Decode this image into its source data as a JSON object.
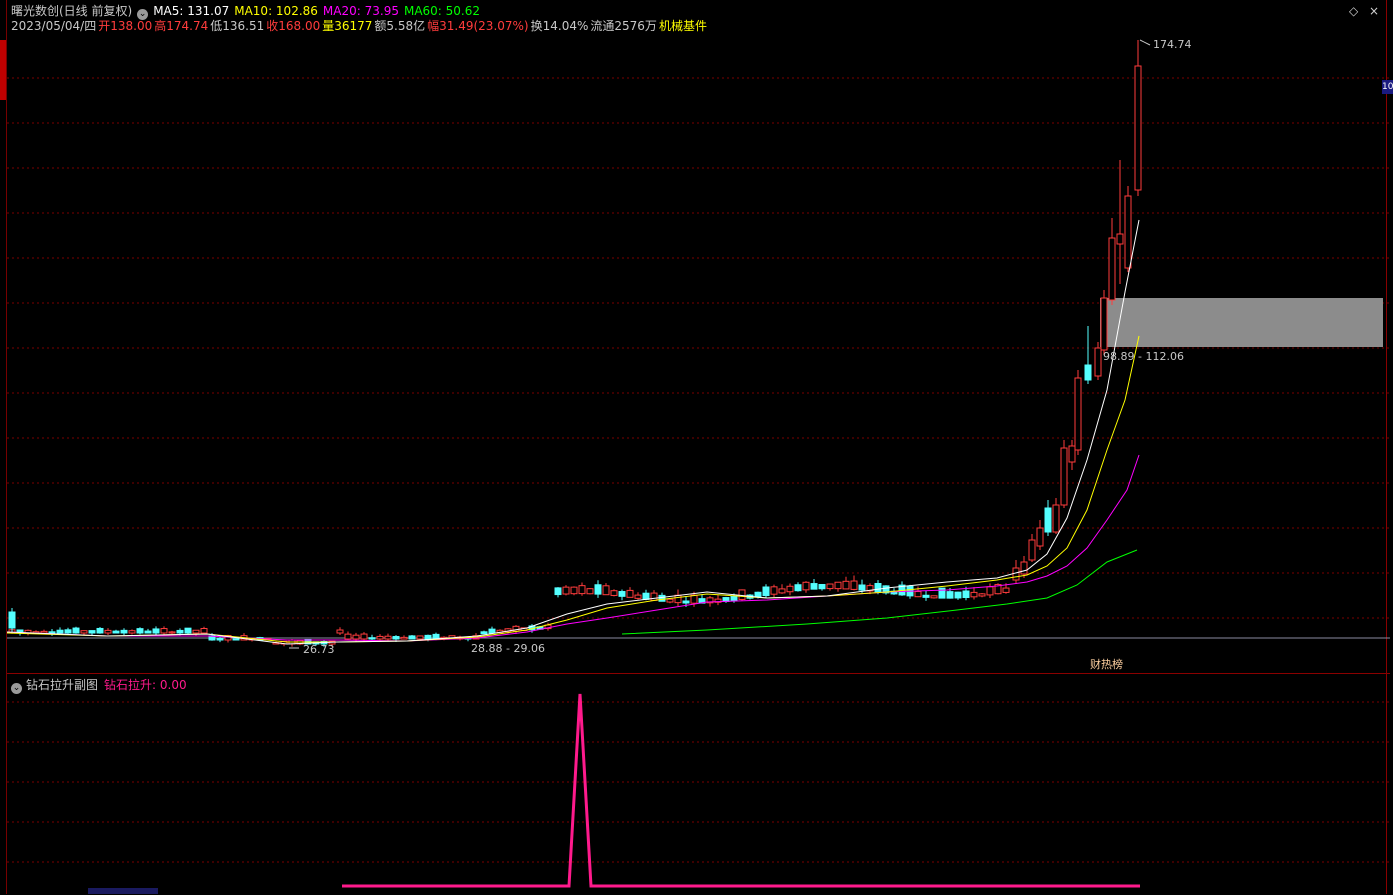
{
  "header": {
    "title": "曙光数创(日线 前复权)",
    "ma5": "MA5: 131.07",
    "ma10": "MA10: 102.86",
    "ma20": "MA20: 73.95",
    "ma60": "MA60: 50.62",
    "date": "2023/05/04/四",
    "open": "开138.00",
    "high": "高174.74",
    "low": "低136.51",
    "close": "收168.00",
    "volume": "量36177",
    "amount": "额5.58亿",
    "change": "幅31.49(23.07%)",
    "turnover": "换14.04%",
    "float": "流通2576万",
    "sector": "机械基件"
  },
  "controls": {
    "diamond": "◇",
    "close": "×"
  },
  "annotations": {
    "high_price": "174.74",
    "gap_range": "98.89 - 112.06",
    "low_price": "26.73",
    "base_range": "28.88 - 29.06",
    "finance_tag": "财热榜"
  },
  "indicator": {
    "name": "钻石拉升副图",
    "series_label": "钻石拉升: 0.00"
  },
  "colors": {
    "up": "#ff3c3c",
    "down": "#54ffff",
    "ma5": "#ffffff",
    "ma10": "#ffff00",
    "ma20": "#ff00ff",
    "ma60": "#00ff00",
    "indicator": "#ff1a8c",
    "gap_box": "#8c8c8c"
  },
  "chart_data": {
    "type": "candlestick",
    "price_high": 174.74,
    "price_low": 26.73,
    "recent_closes": [
      42,
      45,
      58,
      68,
      88,
      110,
      105,
      130,
      138,
      168
    ],
    "indicator_values": [
      0,
      0,
      0,
      0,
      0,
      1,
      0,
      0,
      0,
      0
    ]
  }
}
